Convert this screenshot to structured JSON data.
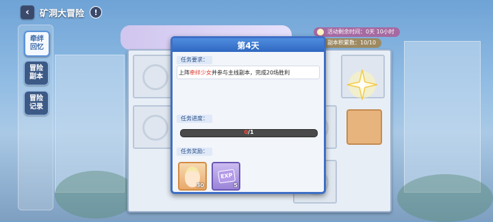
{
  "header": {
    "title": "矿洞大冒险",
    "back_icon": "chevron-left-icon",
    "info_icon": "exclamation-icon",
    "info_glyph": "!"
  },
  "sidebar": {
    "items": [
      {
        "label": "牵绊\n回忆",
        "active": true
      },
      {
        "label": "冒险\n副本",
        "active": false
      },
      {
        "label": "冒险\n记录",
        "active": false
      }
    ]
  },
  "event_info": {
    "time_label": "活动剩余时间：",
    "time_value": "0天 10小时",
    "points_label": "副本积累数：",
    "points_value": "10/10"
  },
  "modal": {
    "title": "第4天",
    "requirement_label": "任务要求：",
    "requirement_prefix": "上阵",
    "requirement_highlight": "牵绊少女",
    "requirement_suffix": "并参与主线副本，完成20场胜利",
    "progress_label": "任务进度：",
    "progress_current": "0",
    "progress_total": "/1",
    "progress_fraction": 0,
    "reward_label": "任务奖励：",
    "rewards": [
      {
        "icon": "character-portrait-icon",
        "count": "30"
      },
      {
        "icon": "exp-book-icon",
        "badge": "EXP",
        "count": "5"
      }
    ]
  },
  "colors": {
    "accent": "#3d6fc6",
    "highlight": "#e0382e"
  }
}
